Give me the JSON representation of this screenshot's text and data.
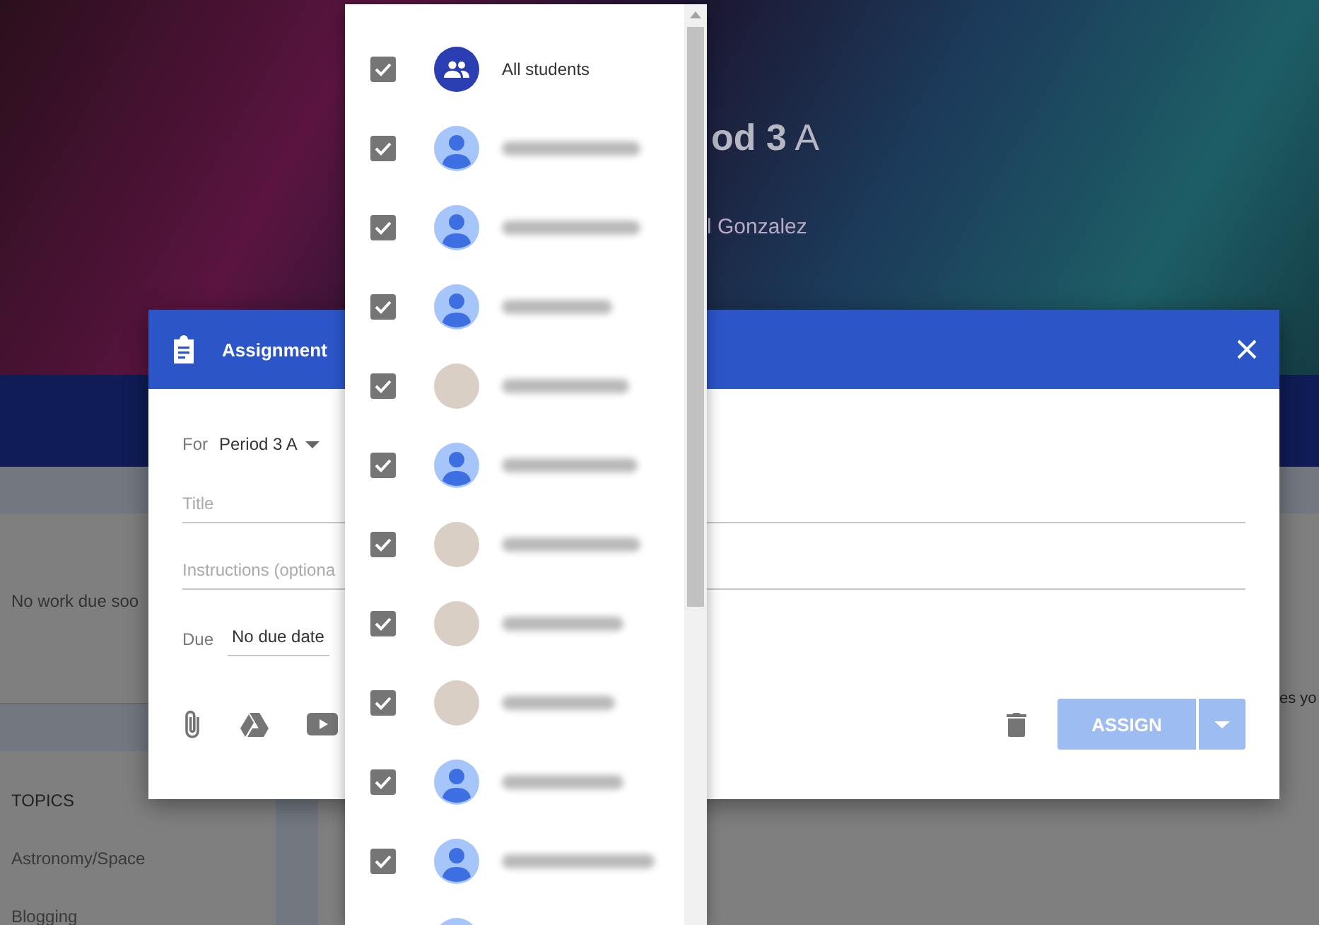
{
  "class_header": {
    "title": "**od 3** A",
    "teacher": "l Gonzalez"
  },
  "upcoming": {
    "text": "No work due soo"
  },
  "topics": {
    "heading": "TOPICS",
    "items": [
      "Astronomy/Space",
      "Blogging"
    ]
  },
  "stream_snippet": "es yo",
  "dialog": {
    "title": "Assignment",
    "for_label": "For",
    "for_value": "Period 3 A",
    "title_placeholder": "Title",
    "instructions_placeholder": "Instructions (optiona",
    "due_label": "Due",
    "due_value": "No due date",
    "assign_button": "ASSIGN",
    "assign_disabled": true
  },
  "student_menu": {
    "items": [
      {
        "kind": "group",
        "label": "All students",
        "checked": true
      },
      {
        "kind": "default",
        "checked": true
      },
      {
        "kind": "default",
        "checked": true
      },
      {
        "kind": "default",
        "checked": true
      },
      {
        "kind": "picture",
        "checked": true
      },
      {
        "kind": "default",
        "checked": true
      },
      {
        "kind": "picture",
        "checked": true
      },
      {
        "kind": "picture",
        "checked": true
      },
      {
        "kind": "picture",
        "checked": true
      },
      {
        "kind": "default",
        "checked": true
      },
      {
        "kind": "default",
        "checked": true
      },
      {
        "kind": "default"
      }
    ]
  }
}
